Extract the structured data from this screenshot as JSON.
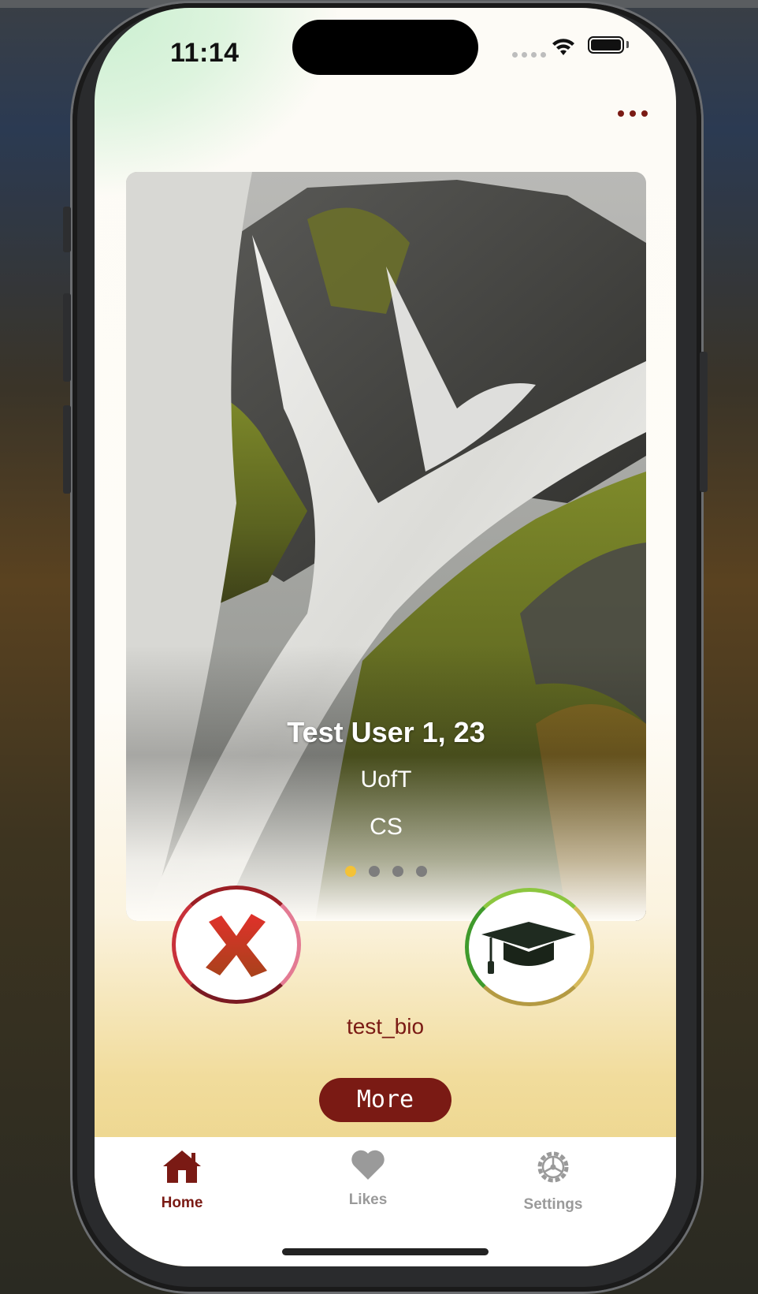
{
  "status_bar": {
    "time": "11:14"
  },
  "profile": {
    "name_age": "Test User 1, 23",
    "school": "UofT",
    "program": "CS",
    "bio": "test_bio",
    "photo_count": 4,
    "current_photo_index": 0
  },
  "actions": {
    "more_label": "More"
  },
  "tabs": [
    {
      "label": "Home",
      "icon": "house-icon",
      "active": true
    },
    {
      "label": "Likes",
      "icon": "heart-icon",
      "active": false
    },
    {
      "label": "Settings",
      "icon": "gear-icon",
      "active": false
    }
  ],
  "colors": {
    "accent": "#7a1a14",
    "active_dot": "#f3c237",
    "inactive_tab": "#9a9a9a"
  }
}
